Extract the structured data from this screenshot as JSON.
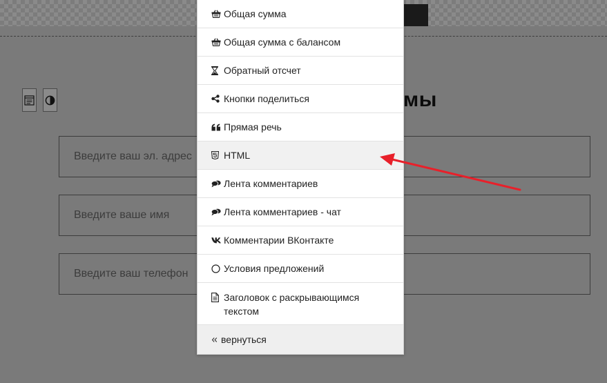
{
  "background": {
    "heading_tail": "мы",
    "fields": [
      {
        "placeholder": "Введите ваш эл. адрес"
      },
      {
        "placeholder": "Введите ваше имя"
      },
      {
        "placeholder": "Введите ваш телефон"
      }
    ],
    "tool_buttons": [
      {
        "icon": "form-icon"
      },
      {
        "icon": "contrast-icon"
      }
    ]
  },
  "menu": {
    "items": [
      {
        "label": "Общая сумма",
        "icon": "basket-icon"
      },
      {
        "label": "Общая сумма с балансом",
        "icon": "basket-icon"
      },
      {
        "label": "Обратный отсчет",
        "icon": "hourglass-icon"
      },
      {
        "label": "Кнопки поделиться",
        "icon": "share-icon"
      },
      {
        "label": "Прямая речь",
        "icon": "quote-icon"
      },
      {
        "label": "HTML",
        "icon": "html5-icon"
      },
      {
        "label": "Лента комментариев",
        "icon": "comments-icon"
      },
      {
        "label": "Лента комментариев - чат",
        "icon": "comments-icon"
      },
      {
        "label": "Комментарии ВКонтакте",
        "icon": "vk-icon"
      },
      {
        "label": "Условия предложений",
        "icon": "circle-icon"
      },
      {
        "label": "Заголовок с раскрывающимся текстом",
        "icon": "document-icon"
      }
    ],
    "back_label": "вернуться",
    "back_icon": "double-chevron-left-icon",
    "highlighted_item": "HTML"
  },
  "annotation": {
    "arrow_color": "#e8202a",
    "points_to": "HTML"
  }
}
